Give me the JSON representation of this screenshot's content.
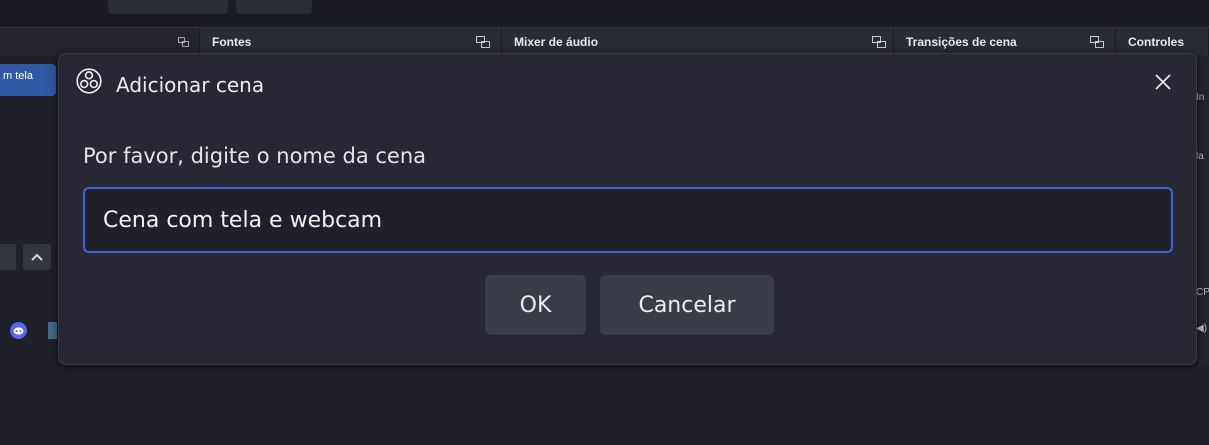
{
  "app": {
    "docks": [
      {
        "label": "Fontes"
      },
      {
        "label": "Mixer de áudio"
      },
      {
        "label": "Transições de cena"
      },
      {
        "label": "Controles"
      }
    ],
    "scene_item_partial": "m tela",
    "right_cut_texts": [
      "In",
      "la",
      "CPU",
      "◀)"
    ]
  },
  "dialog": {
    "title": "Adicionar cena",
    "prompt": "Por favor, digite o nome da cena",
    "input_value": "Cena com tela e webcam",
    "ok_label": "OK",
    "cancel_label": "Cancelar",
    "close_glyph": "✕"
  },
  "colors": {
    "accent": "#3d63d6",
    "dialog_bg": "#272833",
    "button_bg": "#3a3c47",
    "discord": "#5865f2"
  }
}
